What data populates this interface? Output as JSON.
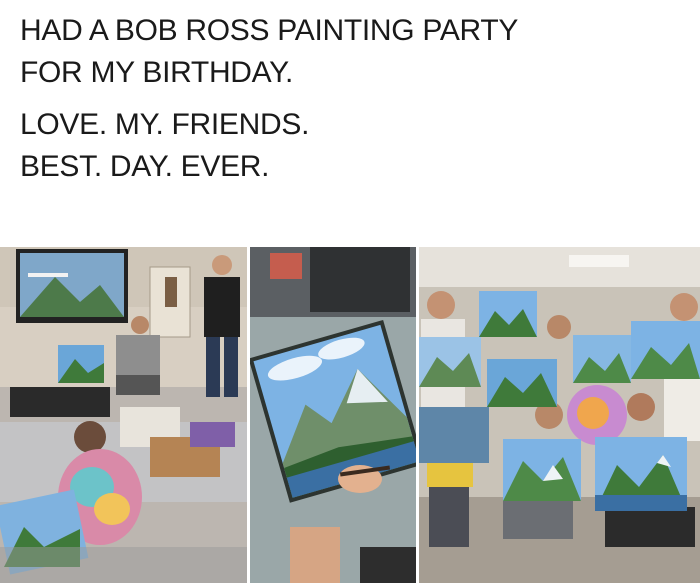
{
  "caption": {
    "line1": "HAD A BOB ROSS PAINTING PARTY",
    "line2": "FOR MY BIRTHDAY.",
    "line3": "LOVE. MY. FRIENDS.",
    "line4": "BEST. DAY. EVER."
  },
  "photos": [
    {
      "name": "photo-painting-party-room"
    },
    {
      "name": "photo-painting-closeup"
    },
    {
      "name": "photo-friends-group"
    }
  ],
  "colors": {
    "text": "#1a1a1a",
    "background": "#ffffff",
    "sky": "#6aa6d8",
    "mountain_green": "#3f7a3a",
    "water": "#3a6fa3"
  }
}
